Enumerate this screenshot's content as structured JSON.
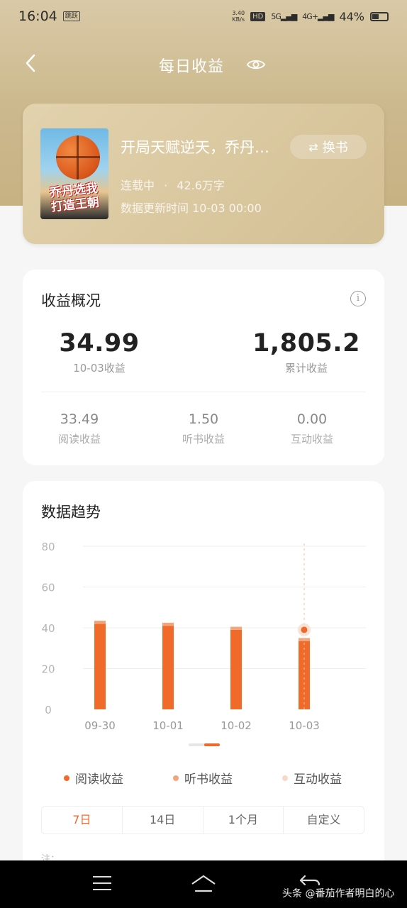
{
  "status_bar": {
    "time": "16:04",
    "sim_badge": "跳跃",
    "net_speed_value": "3.40",
    "net_speed_unit": "KB/s",
    "hd_label": "HD",
    "network_5g": "5G",
    "network_4g": "4G+",
    "battery_percent": "44%"
  },
  "nav": {
    "title": "每日收益"
  },
  "book": {
    "cover_text": "乔丹选我\n打造王朝",
    "title": "开局天赋逆天，乔丹选我打造王朝",
    "switch_label": "换书",
    "status": "连载中",
    "separator": "·",
    "word_count": "42.6万字",
    "update_time": "数据更新时间 10-03 00:00"
  },
  "overview": {
    "title": "收益概况",
    "daily_value": "34.99",
    "daily_label": "10-03收益",
    "total_value": "1,805.2",
    "total_label": "累计收益",
    "read_value": "33.49",
    "read_label": "阅读收益",
    "listen_value": "1.50",
    "listen_label": "听书收益",
    "interact_value": "0.00",
    "interact_label": "互动收益"
  },
  "trend": {
    "title": "数据趋势",
    "legend": [
      "阅读收益",
      "听书收益",
      "互动收益"
    ],
    "tabs": [
      "7日",
      "14日",
      "1个月",
      "自定义"
    ],
    "active_tab": 0,
    "note": "注："
  },
  "chart_data": {
    "type": "bar",
    "stacked": true,
    "categories": [
      "09-30",
      "10-01",
      "10-02",
      "10-03"
    ],
    "series": [
      {
        "name": "阅读收益",
        "values": [
          42,
          41,
          39,
          33.49
        ],
        "color": "#f06a2a"
      },
      {
        "name": "听书收益",
        "values": [
          1.5,
          1.5,
          1.5,
          1.5
        ],
        "color": "#f2a47c"
      },
      {
        "name": "互动收益",
        "values": [
          0,
          0,
          0,
          0
        ],
        "color": "#f8d9c8"
      }
    ],
    "ylim": [
      0,
      80
    ],
    "yticks": [
      "80",
      "60",
      "40",
      "20",
      "0"
    ],
    "grid": true,
    "highlight_category": "10-03",
    "highlight_value": 39
  },
  "colors": {
    "accent": "#ee6a2c",
    "gold": "#cbb88c"
  },
  "system_nav": {
    "watermark": "头条 @番茄作者明白的心"
  }
}
